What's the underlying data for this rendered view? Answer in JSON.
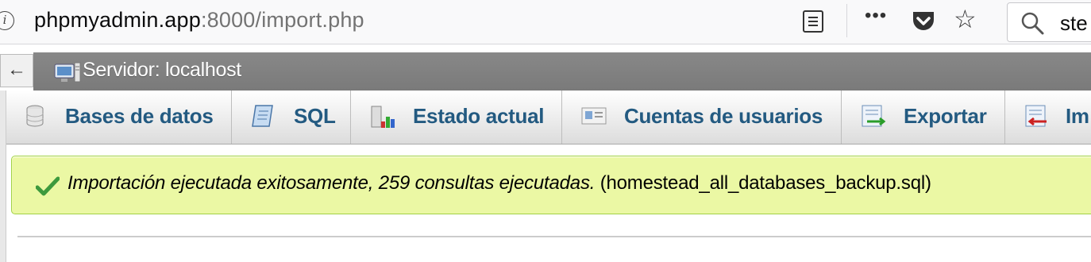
{
  "browser": {
    "url_host": "phpmyadmin.app",
    "url_rest": ":8000/import.php",
    "search_text": "ste"
  },
  "server": {
    "back_label": "←",
    "title": "Servidor: localhost"
  },
  "tabs": [
    {
      "label": "Bases de datos",
      "icon": "database-icon"
    },
    {
      "label": "SQL",
      "icon": "sql-scroll-icon"
    },
    {
      "label": "Estado actual",
      "icon": "status-chart-icon"
    },
    {
      "label": "Cuentas de usuarios",
      "icon": "user-accounts-icon"
    },
    {
      "label": "Exportar",
      "icon": "export-icon"
    },
    {
      "label": "Im",
      "icon": "import-icon"
    }
  ],
  "message": {
    "main": "Importación ejecutada exitosamente, 259 consultas ejecutadas.",
    "file": "(homestead_all_databases_backup.sql)",
    "accent": "#ebf8a4",
    "border": "#a2d246"
  }
}
